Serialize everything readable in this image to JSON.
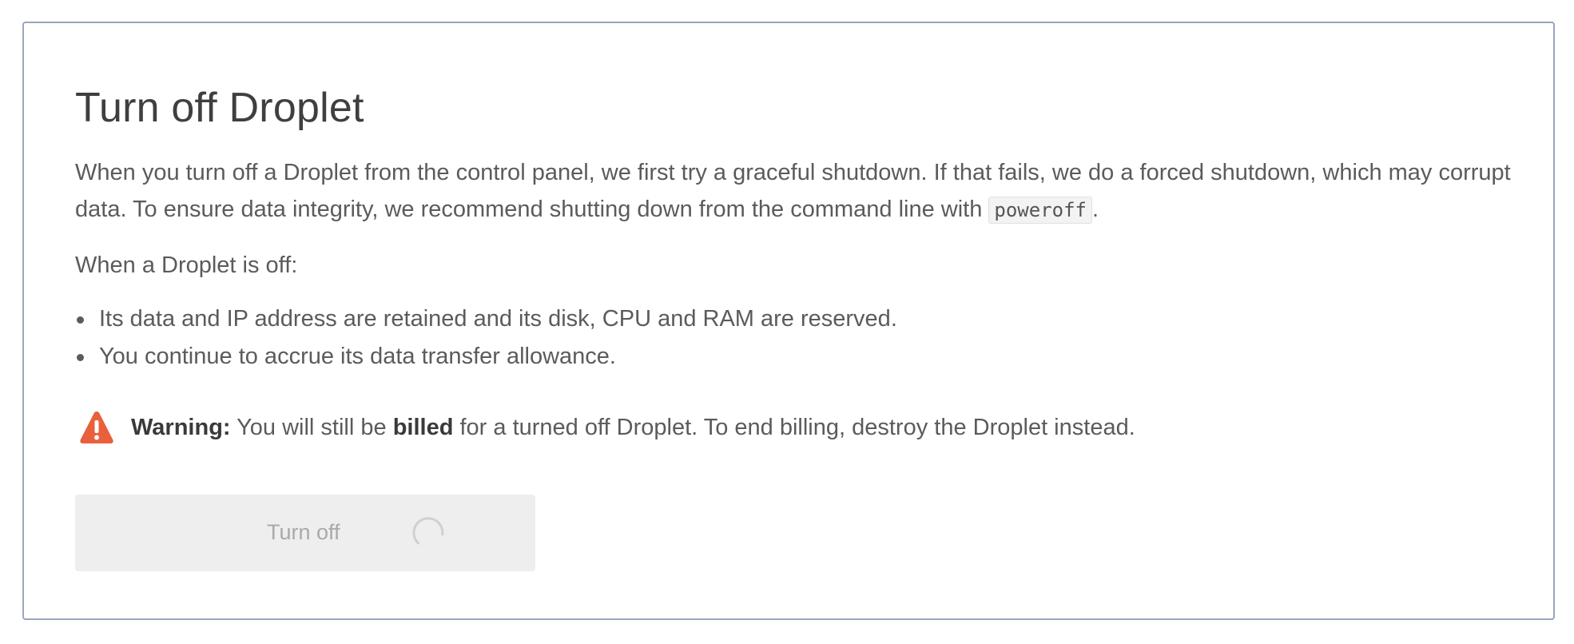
{
  "dialog": {
    "title": "Turn off Droplet",
    "description_before_code": "When you turn off a Droplet from the control panel, we first try a graceful shutdown. If that fails, we do a forced shutdown, which may corrupt data. To ensure data integrity, we recommend shutting down from the command line with ",
    "command": "poweroff",
    "description_after_code": ".",
    "off_intro": "When a Droplet is off:",
    "off_items": [
      "Its data and IP address are retained and its disk, CPU and RAM are reserved.",
      "You continue to accrue its data transfer allowance."
    ],
    "warning": {
      "icon": "warning-triangle-icon",
      "icon_color": "#e8603c",
      "label": "Warning:",
      "text_before": " You will still be ",
      "emphasis": "billed",
      "text_after": " for a turned off Droplet. To end billing, destroy the Droplet instead."
    },
    "button": {
      "label": "Turn off",
      "state": "loading",
      "spinner_icon": "spinner-icon"
    }
  }
}
